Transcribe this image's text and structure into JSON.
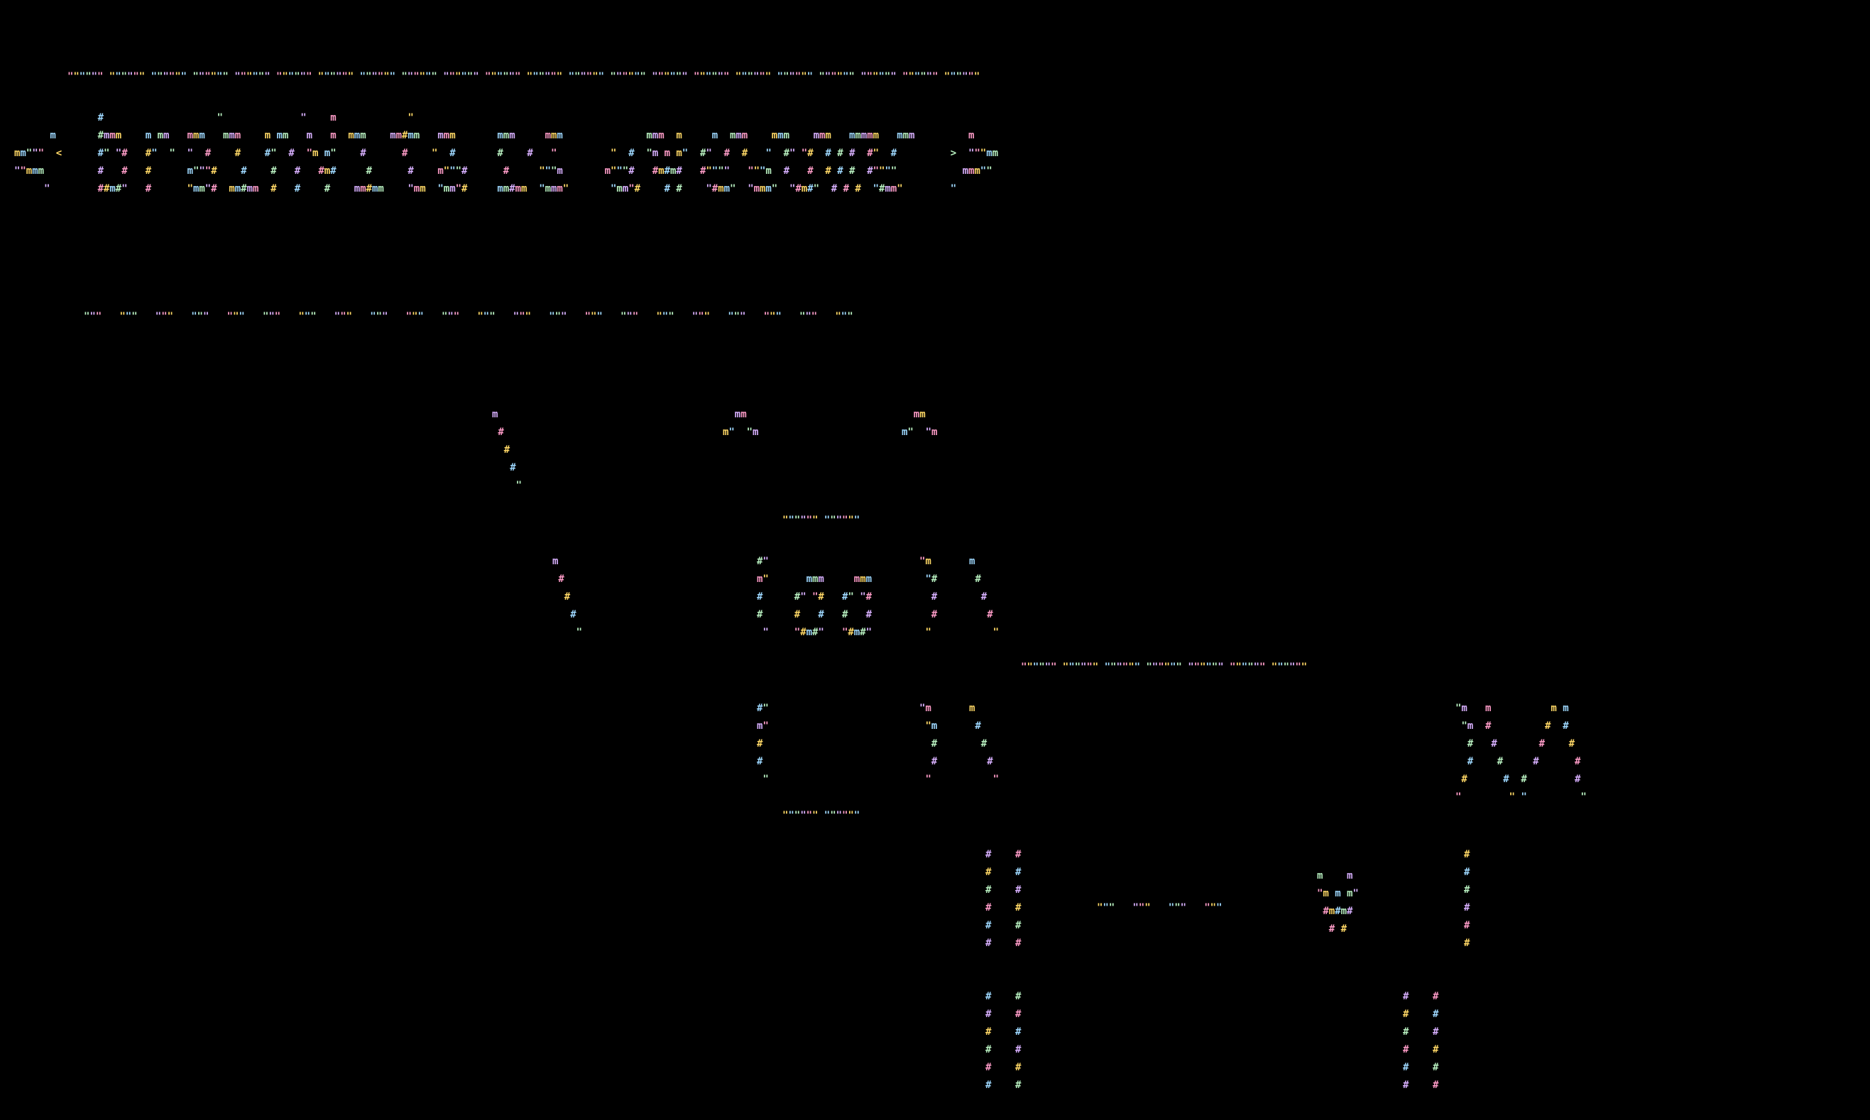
{
  "art_text": "brainmyt is awesome",
  "palette": [
    "#ff9cc8",
    "#ffd866",
    "#9ed8ff",
    "#b8f0c0",
    "#d8b0ff"
  ],
  "background": "#000000",
  "banner": {
    "border_top": "\"\"\"\"\"\" \"\"\"\"\"\" \"\"\"\"\"\" \"\"\"\"\"\" \"\"\"\"\"\" \"\"\"\"\"\" \"\"\"\"\"\" \"\"\"\"\"\" \"\"\"\"\"\" \"\"\"\"\"\" \"\"\"\"\"\" \"\"\"\"\"\" \"\"\"\"\"\" \"\"\"\"\"\" \"\"\"\"\"\" \"\"\"\"\"\" \"\"\"\"\"\" \"\"\"\"\"\" \"\"\"\"\"\" \"\"\"\"\"\" \"\"\"\"\"\" \"\"\"\"\"\"",
    "lines": [
      "              #                   \"             \"    m            \"",
      "      m       #mmm    m mm   mmm   mmm    m mm   m   m  mmm    mm#mm   mmm       mmm     mmm              mmm  m     m  mmm    mmm    mmm   mmmmm   mmm         m",
      "mm\"\"\"  <      #\" \"#   #\"  \"  \"  #    #    #\"  #  \"m m\"    #      #    \"  #       #    #   \"         \"  #  \"m m m\"  #\"  #  #   \"  #\" \"#  # # #  #\"  #         >  \"\"\"mm",
      "\"\"mmm         #   #   #      m\"\"\"#    #    #   #   #m#     #      #    m\"\"\"#      #     \"\"\"m       m\"\"\"#   #m#m#   #\"\"\"\"   \"\"\"m  #   #  # # #  #\"\"\"\"           mmm\"\"",
      "     \"        ##m#\"   #      \"mm\"#  mm#mm  #   #    #    mm#mm    \"mm  \"mm\"#     mm#mm  \"mmm\"       \"mm\"#    # #    \"#mm\"  \"mmm\"  \"#m#\"  # # #  \"#mm\"        \""
    ],
    "border_bottom": "\"\"\"   \"\"\"   \"\"\"   \"\"\"   \"\"\"   \"\"\"   \"\"\"   \"\"\"   \"\"\"   \"\"\"   \"\"\"   \"\"\"   \"\"\"   \"\"\"   \"\"\"   \"\"\"   \"\"\"   \"\"\"   \"\"\"   \"\"\"   \"\"\"   \"\"\""
  },
  "robot": {
    "antennae": {
      "left": "m\n #\n  #\n   #\n    \"",
      "top_left": "  mm\nm\"  \"m",
      "top_right": "  mm\nm\"  \"m"
    },
    "head_top": "\"\"\"\"\"\" \"\"\"\"\"\"",
    "eyes": "    mmm     mmm\n  #\" \"#   #\" \"#\n  #   #   #   #\n  \"#m#\"   \"#m#\"",
    "body_bottom": "\"\"\"\"\"\" \"\"\"\"\"\"",
    "arm_top": "\"\"\"\"\"\" \"\"\"\"\"\" \"\"\"\"\"\" \"\"\"\"\"\" \"\"\"\"\"\" \"\"\"\"\"\" \"\"\"\"\"\"",
    "tail": "\"\"\"   \"\"\"   \"\"\"   \"\"\"",
    "mouse": "m    m\n\"m m m\"\n #m#m#\n  # #"
  }
}
